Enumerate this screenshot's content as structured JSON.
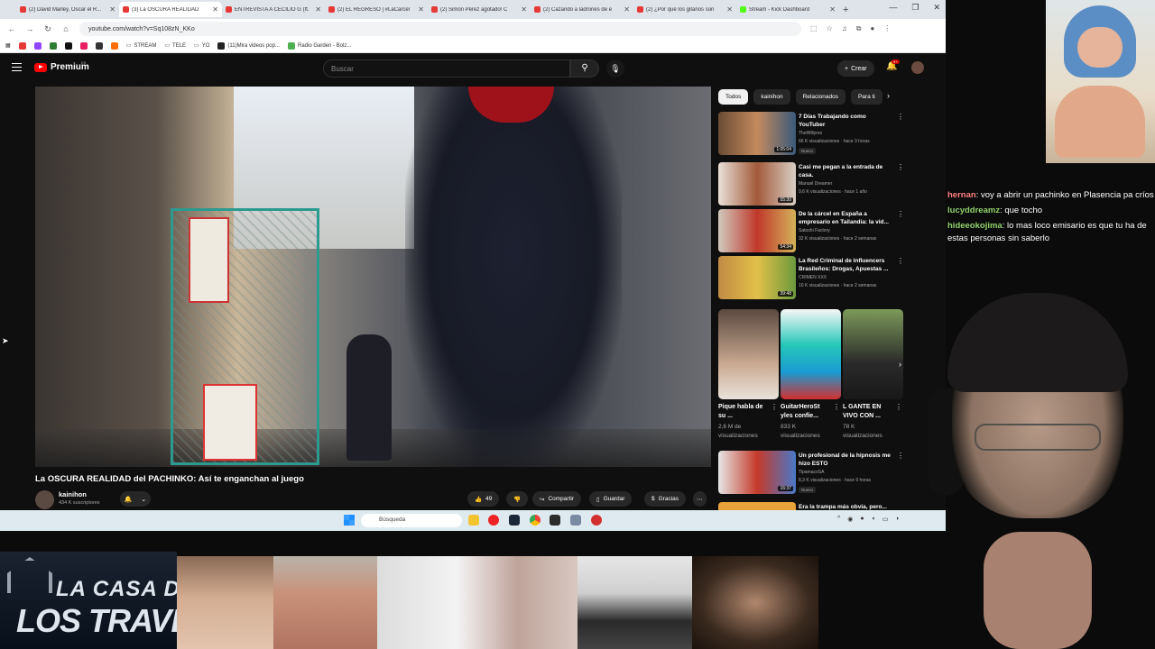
{
  "browser": {
    "tabs": [
      {
        "title": "(2) David Marley, Oscar el R...",
        "active": false
      },
      {
        "title": "(3) La OSCURA REALIDAD",
        "active": true
      },
      {
        "title": "ENTREVISTA A CECILIO G (ft.",
        "active": false
      },
      {
        "title": "(2) EL REGRESO | #LaCarcel",
        "active": false
      },
      {
        "title": "(2) Simón Pérez agotado! C",
        "active": false
      },
      {
        "title": "(2) Cazando a ladrones de e",
        "active": false
      },
      {
        "title": "(2) ¿Por qué los gitanos son",
        "active": false
      },
      {
        "title": "Stream - Kick Dashboard",
        "active": false
      }
    ],
    "new_tab": "+",
    "url": "youtube.com/watch?v=Sq108zN_KKo",
    "bookmarks": [
      "STREAM",
      "TELE",
      "YO",
      "(11)Mira videos pop...",
      "Radio Garden - Bolz..."
    ]
  },
  "youtube": {
    "logo": "Premium",
    "logo_sup": "ES",
    "search_placeholder": "Buscar",
    "create_label": "Crear",
    "notif_count": "9+",
    "video_title": "La OSCURA REALIDAD del PACHINKO: Así te enganchan al juego",
    "channel": {
      "name": "kainihon",
      "subs": "434 K suscriptores"
    },
    "actions": {
      "likes": "49",
      "share": "Compartir",
      "save": "Guardar",
      "thanks": "Gracias"
    },
    "chips": [
      "Todos",
      "kainihon",
      "Relacionados",
      "Para ti"
    ],
    "recommendations": [
      {
        "title": "7 Días Trabajando como YouTuber",
        "channel": "TheWillyrex",
        "meta": "66 K visualizaciones · hace 3 horas",
        "duration": "1:05:04",
        "badge": "Nuevo"
      },
      {
        "title": "Casi me pegan a la entrada de casa.",
        "channel": "Manuel Dreamer",
        "meta": "9,6 K visualizaciones · hace 1 año",
        "duration": "55:30",
        "badge": ""
      },
      {
        "title": "De la cárcel en España a empresario en Tailandia: la vid...",
        "channel": "Satoshi Factory",
        "meta": "32 K visualizaciones · hace 2 semanas",
        "duration": "54:34",
        "badge": ""
      },
      {
        "title": "La Red Criminal de Influencers Brasileños: Drogas, Apuestas ...",
        "channel": "CRIMEN XXX",
        "meta": "10 K visualizaciones · hace 2 semanas",
        "duration": "39:48",
        "badge": ""
      },
      {
        "title": "Un profesional de la hipnosis me hizo ESTO",
        "channel": "TipamacoSA",
        "meta": "8,3 K visualizaciones · hace 9 horas",
        "duration": "16:37",
        "badge": "Nuevo"
      },
      {
        "title": "Era la trampa más obvia, pero...",
        "channel": "",
        "meta": "",
        "duration": "",
        "badge": ""
      }
    ],
    "shorts": [
      {
        "title": "Pique habla de su ...",
        "views": "2,6 M de visualizaciones"
      },
      {
        "title": "GuitarHeroSt yles confie...",
        "views": "833 K visualizaciones"
      },
      {
        "title": "L GANTE EN VIVO CON ...",
        "views": "78 K visualizaciones"
      }
    ]
  },
  "taskbar": {
    "search_placeholder": "Búsqueda"
  },
  "chat": [
    {
      "user": "hernan",
      "color": "#ff7f7f",
      "text": ": voy a abrir un pachinko en Plasencia pa críos"
    },
    {
      "user": "lucyddreamz",
      "color": "#8fd16b",
      "text": ": que tocho"
    },
    {
      "user": "hideeokojima",
      "color": "#8fd16b",
      "text": ": lo mas loco emisario es que tu ha de estas personas sin saberlo"
    }
  ],
  "overlay": {
    "logo_line1": "LA CASA DE",
    "logo_line2": "LOS TRAVELOS"
  }
}
